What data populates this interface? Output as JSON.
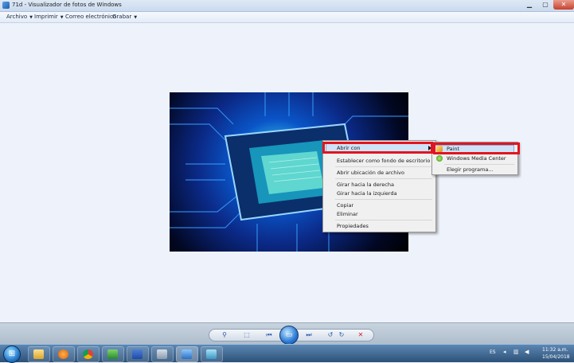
{
  "window": {
    "title": "71d - Visualizador de fotos de Windows"
  },
  "menu": [
    {
      "label": "Archivo",
      "has_arrow": true
    },
    {
      "label": "Imprimir",
      "has_arrow": true
    },
    {
      "label": "Correo electrónico",
      "has_arrow": false
    },
    {
      "label": "Grabar",
      "has_arrow": true
    }
  ],
  "context_menu": {
    "items": [
      "Abrir con",
      "Establecer como fondo de escritorio",
      "Abrir ubicación de archivo",
      "Girar hacia la derecha",
      "Girar hacia la izquierda",
      "Copiar",
      "Eliminar",
      "Propiedades"
    ],
    "highlighted": "Abrir con"
  },
  "submenu": {
    "items": [
      {
        "label": "Paint",
        "icon": "paint-icon"
      },
      {
        "label": "Windows Media Center",
        "icon": "media-center-icon"
      },
      {
        "label": "Elegir programa...",
        "icon": ""
      }
    ],
    "highlighted": "Paint"
  },
  "controls": {
    "zoom": "⚲",
    "actual_size": "⬚",
    "prev": "⏮",
    "slideshow": "▭",
    "next": "⏭",
    "rotate_left": "↺",
    "rotate_right": "↻",
    "delete": "✕"
  },
  "tray": {
    "lang": "ES",
    "time": "11:32 a.m.",
    "date": "15/04/2018"
  },
  "colors": {
    "highlight_outline": "#e3141e",
    "taskbar": "#2d5178"
  }
}
